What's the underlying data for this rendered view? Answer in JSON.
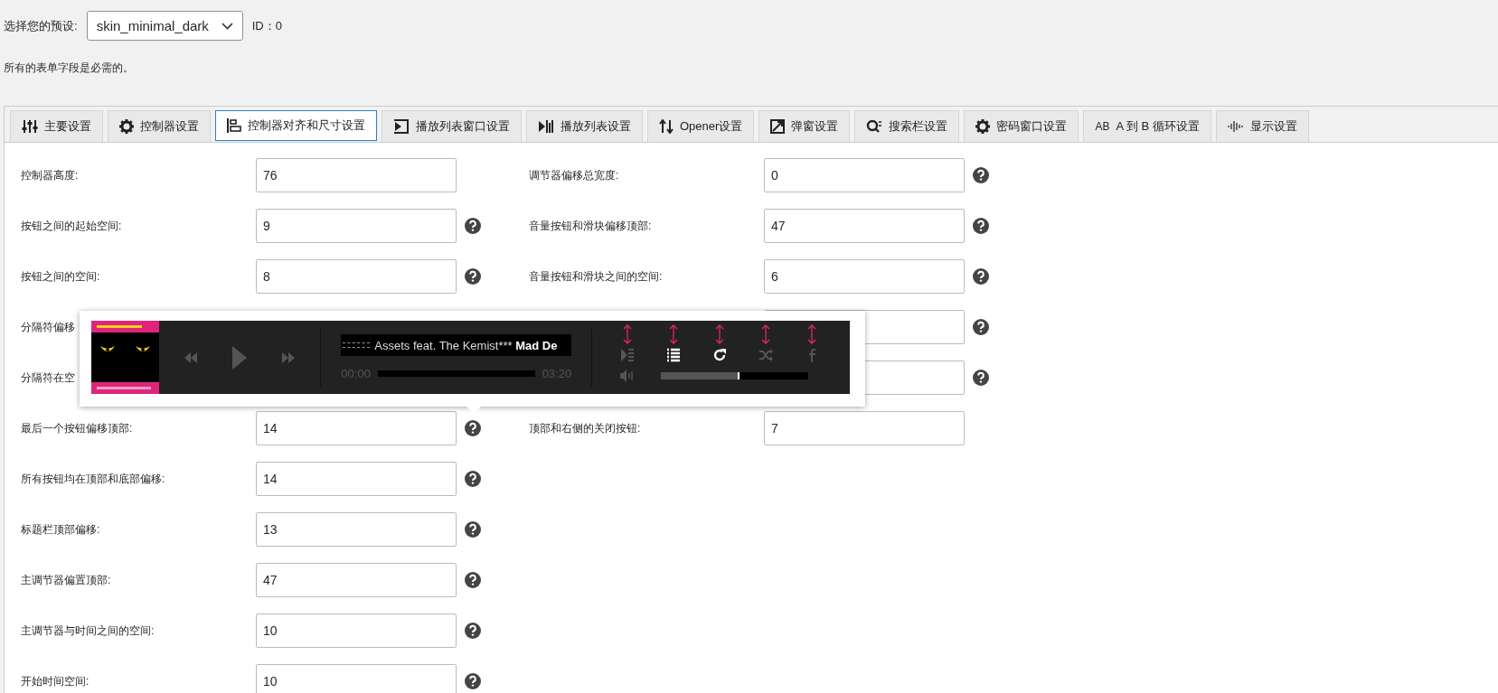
{
  "preset": {
    "label": "选择您的预设:",
    "value": "skin_minimal_dark",
    "id_text": "ID：0"
  },
  "notice": "所有的表单字段是必需的。",
  "tabs": [
    {
      "label": "主要设置",
      "selected": false
    },
    {
      "label": "控制器设置",
      "selected": false
    },
    {
      "label": "控制器对齐和尺寸设置",
      "selected": true
    },
    {
      "label": "播放列表窗口设置",
      "selected": false
    },
    {
      "label": "播放列表设置",
      "selected": false
    },
    {
      "label": "Opener设置",
      "selected": false
    },
    {
      "label": "弹窗设置",
      "selected": false
    },
    {
      "label": "搜索栏设置",
      "selected": false
    },
    {
      "label": "密码窗口设置",
      "selected": false
    },
    {
      "icon_text": "AB",
      "label": "A 到 B 循环设置",
      "selected": false
    },
    {
      "label": "显示设置",
      "selected": false
    }
  ],
  "left_fields": [
    {
      "label": "控制器高度:",
      "value": "76",
      "help": false
    },
    {
      "label": "按钮之间的起始空间:",
      "value": "9",
      "help": true
    },
    {
      "label": "按钮之间的空间:",
      "value": "8",
      "help": true
    },
    {
      "label": "分隔符偏移"
    },
    {
      "label": "分隔符在空"
    },
    {
      "label": "最后一个按钮偏移顶部:",
      "value": "14",
      "help": true
    },
    {
      "label": "所有按钮均在顶部和底部偏移:",
      "value": "14",
      "help": true
    },
    {
      "label": "标题栏顶部偏移:",
      "value": "13",
      "help": true
    },
    {
      "label": "主调节器偏置顶部:",
      "value": "47",
      "help": true
    },
    {
      "label": "主调节器与时间之间的空间:",
      "value": "10",
      "help": true
    },
    {
      "label": "开始时间空间:",
      "value": "10",
      "help": true
    }
  ],
  "right_fields": [
    {
      "label": "调节器偏移总宽度:",
      "value": "0",
      "help": true
    },
    {
      "label": "音量按钮和滑块偏移顶部:",
      "value": "47",
      "help": true
    },
    {
      "label": "音量按钮和滑块之间的空间:",
      "value": "6",
      "help": true
    },
    {
      "field": true,
      "help": true
    },
    {
      "field": true,
      "help": true
    },
    {
      "label": "顶部和右侧的关闭按钮:",
      "value": "7",
      "help": false
    }
  ],
  "preview_player": {
    "kind": "picture",
    "title": "Assets feat. The Kemist***",
    "next_title": "Mad De",
    "elapsed": "00:00",
    "duration": "03:20",
    "progress": {
      "level": 0
    },
    "volume": {
      "level": 0.53
    },
    "buttons": [
      {
        "on": false
      },
      {
        "on": true
      },
      {
        "on": true
      },
      {
        "on": false
      },
      {
        "on": false
      }
    ]
  }
}
